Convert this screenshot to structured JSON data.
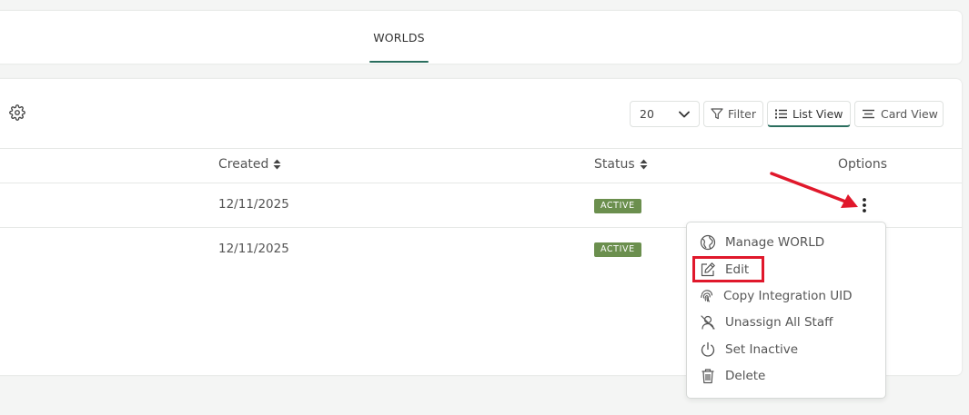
{
  "tabs": {
    "worlds_label": "WORLDS"
  },
  "toolbar": {
    "page_size": "20",
    "filter_label": "Filter",
    "list_view_label": "List View",
    "card_view_label": "Card View"
  },
  "table": {
    "headers": {
      "created": "Created",
      "status": "Status",
      "options": "Options"
    },
    "rows": [
      {
        "created": "12/11/2025",
        "status": "ACTIVE"
      },
      {
        "created": "12/11/2025",
        "status": "ACTIVE"
      }
    ]
  },
  "options_menu": {
    "items": [
      {
        "label": "Manage WORLD",
        "icon": "globe-icon"
      },
      {
        "label": "Edit",
        "icon": "edit-icon"
      },
      {
        "label": "Copy Integration UID",
        "icon": "fingerprint-icon"
      },
      {
        "label": "Unassign All Staff",
        "icon": "user-remove-icon"
      },
      {
        "label": "Set Inactive",
        "icon": "power-icon"
      },
      {
        "label": "Delete",
        "icon": "trash-icon"
      }
    ]
  },
  "colors": {
    "accent": "#2a6e5e",
    "badge_active": "#6b8f4e",
    "annotation_red": "#e0182b"
  }
}
